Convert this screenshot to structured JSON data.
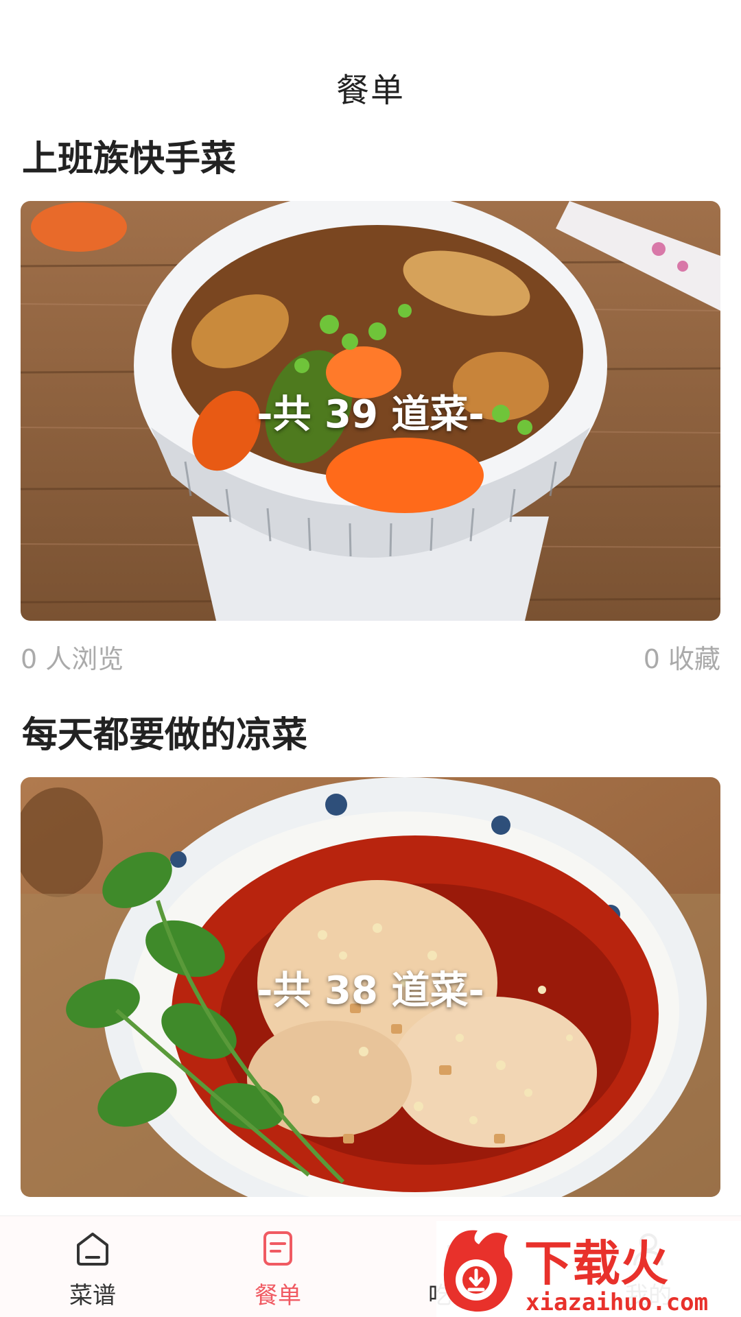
{
  "header": {
    "title": "餐单"
  },
  "cards": [
    {
      "title": "上班族快手菜",
      "dish_count": "-共 39 道菜-",
      "views": "0 人浏览",
      "favorites": "0 收藏"
    },
    {
      "title": "每天都要做的凉菜",
      "dish_count": "-共 38 道菜-"
    }
  ],
  "tabbar": {
    "tabs": [
      {
        "label": "菜谱",
        "icon": "recipe-home-icon"
      },
      {
        "label": "餐单",
        "icon": "menu-list-icon"
      },
      {
        "label": "吃什么",
        "icon": "what-to-eat-icon"
      },
      {
        "label": "我的",
        "icon": "profile-icon"
      }
    ],
    "active_index": 1
  },
  "watermark": {
    "brand": "下载火",
    "url": "xiazaihuo.com"
  },
  "colors": {
    "accent": "#f05a62",
    "title_text": "#222222",
    "meta_text": "#aaaaaa",
    "watermark_red": "#e8312b"
  }
}
